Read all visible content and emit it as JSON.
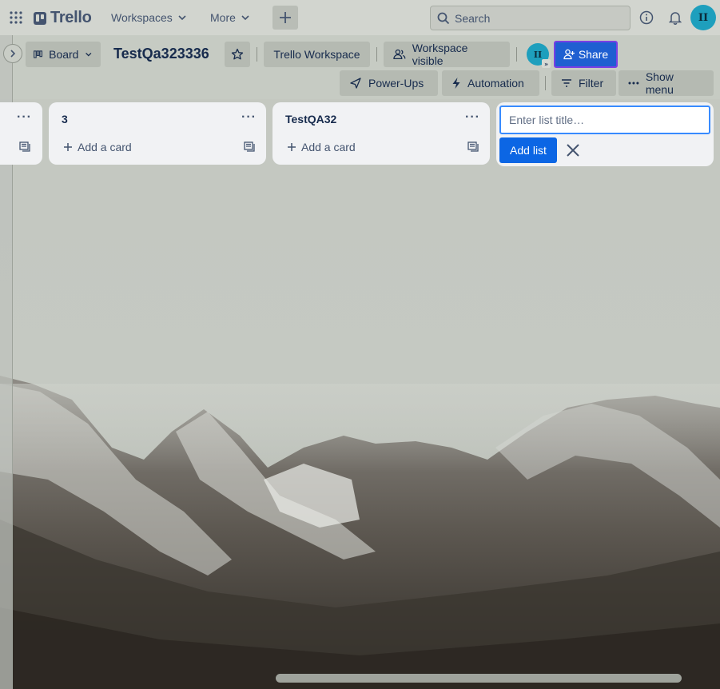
{
  "header": {
    "app_name": "Trello",
    "nav": [
      "Workspaces",
      "More"
    ],
    "search_placeholder": "Search",
    "user_initials": "II"
  },
  "board": {
    "view_label": "Board",
    "title": "TestQa323336",
    "workspace": "Trello Workspace",
    "visibility": "Workspace visible",
    "share_label": "Share",
    "member_initials": "II",
    "actions": [
      "Power-Ups",
      "Automation",
      "Filter",
      "Show menu"
    ]
  },
  "lists": [
    {
      "title": "3",
      "add_card": "Add a card"
    },
    {
      "title": "TestQA32",
      "add_card": "Add a card"
    }
  ],
  "add_list": {
    "placeholder": "Enter list title…",
    "button": "Add list"
  },
  "colors": {
    "accent": "#0c66e4",
    "share": "#1f5fd1",
    "avatar": "#1e9fbd"
  }
}
